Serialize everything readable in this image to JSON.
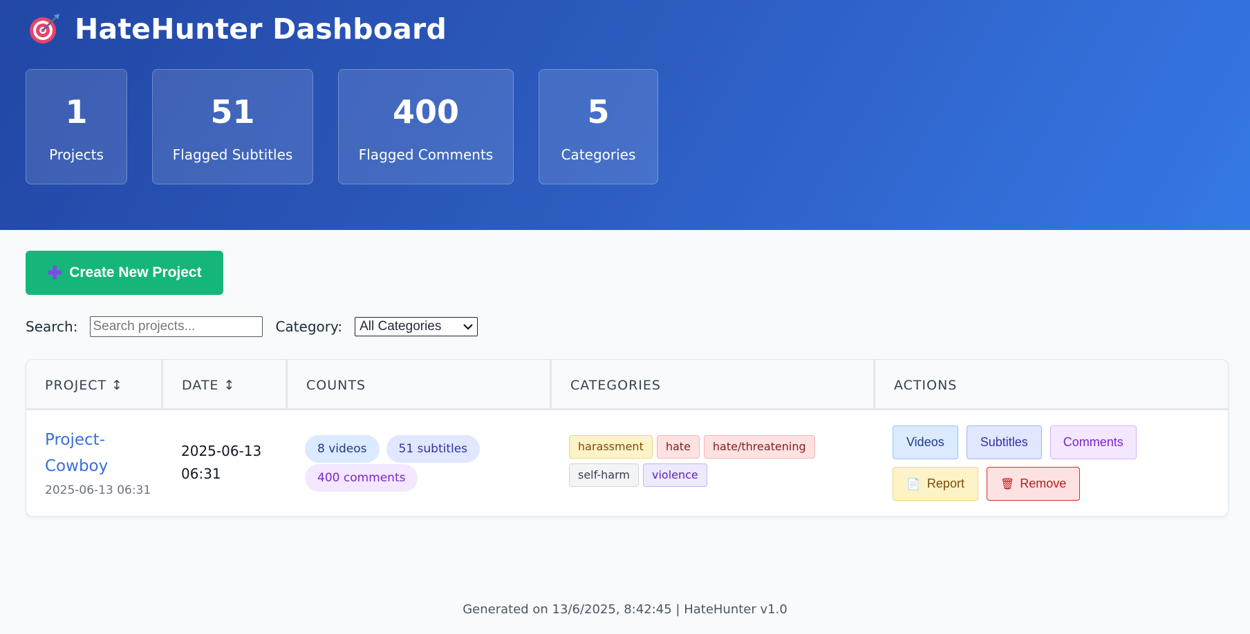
{
  "header": {
    "title": "HateHunter Dashboard",
    "logo_icon": "target-dart-icon"
  },
  "stats": [
    {
      "value": "1",
      "label": "Projects"
    },
    {
      "value": "51",
      "label": "Flagged Subtitles"
    },
    {
      "value": "400",
      "label": "Flagged Comments"
    },
    {
      "value": "5",
      "label": "Categories"
    }
  ],
  "create_button": {
    "label": "Create New Project",
    "icon": "plus-icon"
  },
  "filters": {
    "search_label": "Search:",
    "search_placeholder": "Search projects...",
    "category_label": "Category:",
    "category_selected": "All Categories"
  },
  "table": {
    "headers": {
      "project": "PROJECT ↕",
      "date": "DATE ↕",
      "counts": "COUNTS",
      "categories": "CATEGORIES",
      "actions": "ACTIONS"
    },
    "rows": [
      {
        "project_name_1": "Project-",
        "project_name_2": "Cowboy",
        "project_sub": "2025-06-13 06:31",
        "date_1": "2025-06-13",
        "date_2": "06:31",
        "counts": {
          "videos": "8 videos",
          "subtitles": "51 subtitles",
          "comments": "400 comments"
        },
        "categories": [
          "harassment",
          "hate",
          "hate/threatening",
          "self-harm",
          "violence"
        ],
        "actions": {
          "videos": "Videos",
          "subtitles": "Subtitles",
          "comments": "Comments",
          "report": "Report",
          "remove": "Remove"
        }
      }
    ]
  },
  "footer": "Generated on 13/6/2025, 8:42:45 | HateHunter v1.0",
  "colors": {
    "header_start": "#2247a5",
    "header_end": "#3578e5",
    "create_button": "#16b67a",
    "link": "#3b6fd6"
  }
}
